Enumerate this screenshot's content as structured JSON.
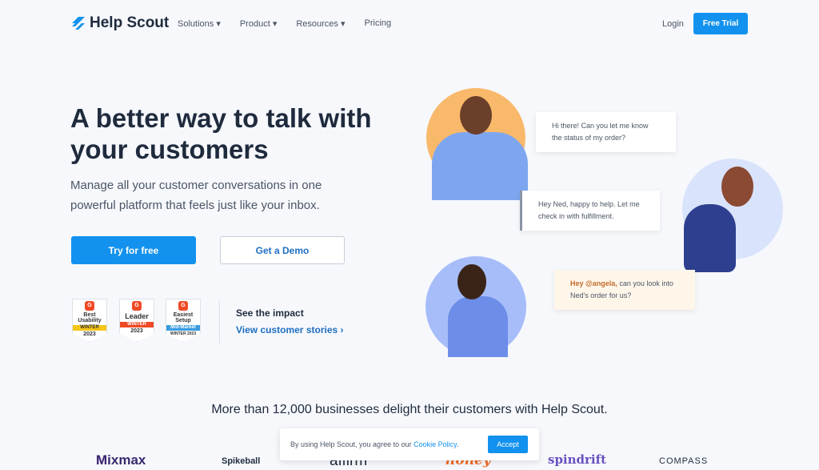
{
  "brand": {
    "name": "Help Scout",
    "accent": "#1292ee"
  },
  "nav": {
    "items": [
      "Solutions",
      "Product",
      "Resources",
      "Pricing"
    ],
    "login": "Login",
    "cta": "Free Trial"
  },
  "hero": {
    "title": "A better way to talk with your customers",
    "subtitle": "Manage all your customer conversations in one powerful platform that feels just like your inbox.",
    "primary": "Try for free",
    "secondary": "Get a Demo"
  },
  "badges": [
    {
      "line1": "Best",
      "line2": "Usability",
      "ribbon": "WINTER",
      "year": "2023",
      "color": "#f5c518"
    },
    {
      "line1": "Leader",
      "line2": "",
      "ribbon": "WINTER",
      "year": "2023",
      "color": "#ef4a26"
    },
    {
      "line1": "Easiest",
      "line2": "Setup",
      "ribbon": "Mid-Market",
      "year": "WINTER 2023",
      "color": "#3a9ce0"
    }
  ],
  "impact": {
    "heading": "See the impact",
    "link": "View customer stories ›"
  },
  "chat": {
    "b1": "Hi there! Can you let me know the status of my order?",
    "b2": "Hey Ned, happy to help. Let me check in with fulfillment.",
    "b3_mention": "Hey @angela,",
    "b3_rest": " can you look into Ned's order for us?"
  },
  "tagline": "More than 12,000 businesses delight their customers with Help Scout.",
  "logos": [
    "Mixmax",
    "Spikeball",
    "affirm",
    "honey",
    "spindrift",
    "COMPASS"
  ],
  "cookie": {
    "text": "By using Help Scout, you agree to our ",
    "link": "Cookie Policy",
    "end": ".",
    "accept": "Accept"
  }
}
